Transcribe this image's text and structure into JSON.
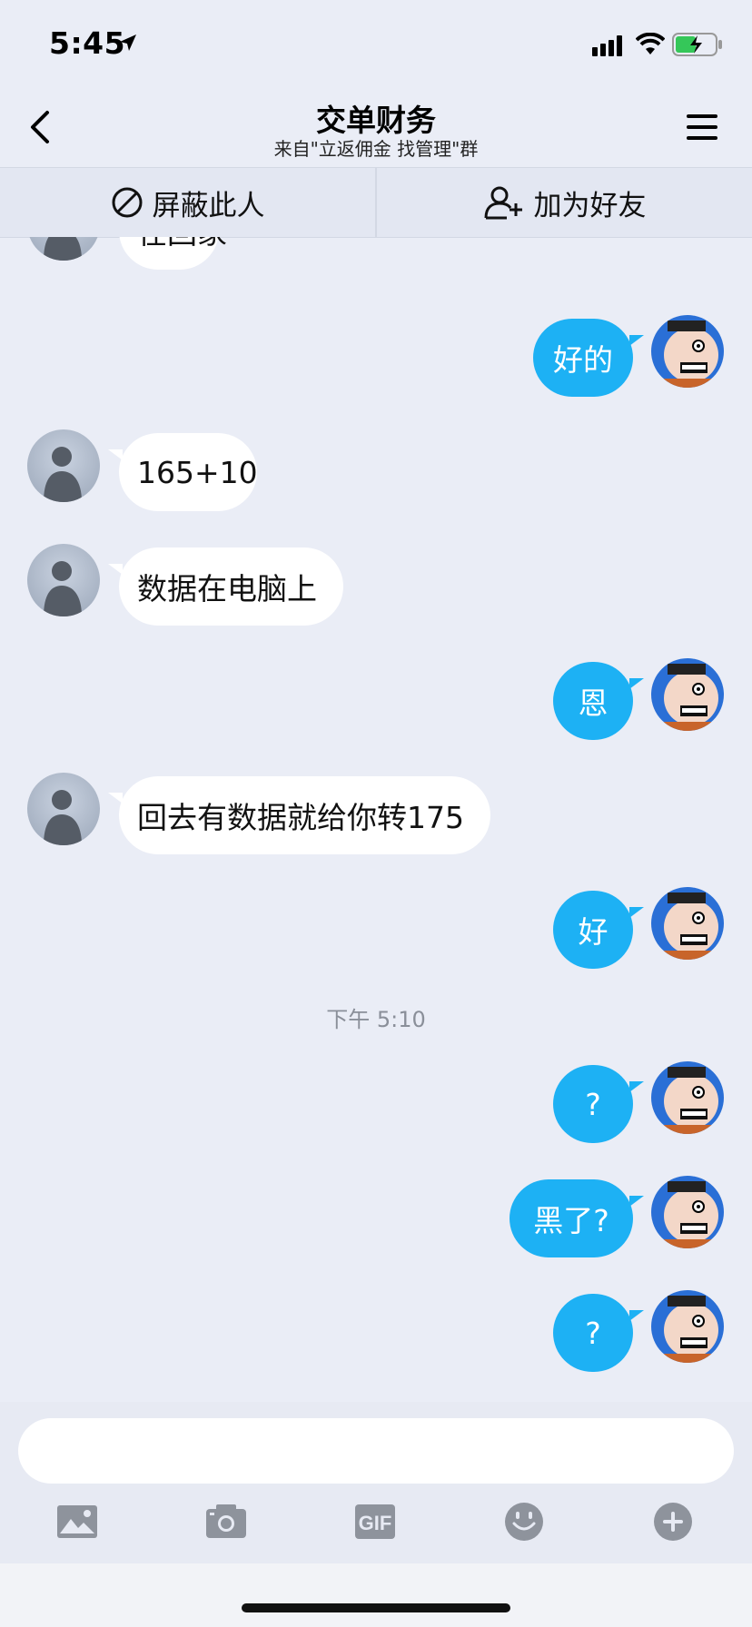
{
  "status_bar": {
    "time": "5:45"
  },
  "nav": {
    "title": "交单财务",
    "subtitle": "来自\"立返佣金  找管理\"群"
  },
  "actions": {
    "block_label": "屏蔽此人",
    "add_label": "加为好友"
  },
  "messages": [
    {
      "side": "in",
      "text": "在回家"
    },
    {
      "side": "out",
      "text": "好的"
    },
    {
      "side": "in",
      "text": "165+10"
    },
    {
      "side": "in",
      "text": "数据在电脑上"
    },
    {
      "side": "out",
      "text": "恩"
    },
    {
      "side": "in",
      "text": "回去有数据就给你转175"
    },
    {
      "side": "out",
      "text": "好"
    },
    {
      "timestamp": "下午 5:10"
    },
    {
      "side": "out",
      "text": "?"
    },
    {
      "side": "out",
      "text": "黑了?"
    },
    {
      "side": "out",
      "text": "?"
    }
  ],
  "input": {
    "placeholder": ""
  },
  "toolbar": [
    "image-icon",
    "camera-icon",
    "gif-icon",
    "emoji-icon",
    "plus-icon"
  ],
  "colors": {
    "outgoing_bubble": "#1db1f4",
    "incoming_bubble": "#ffffff",
    "background": "#eaedf6"
  }
}
